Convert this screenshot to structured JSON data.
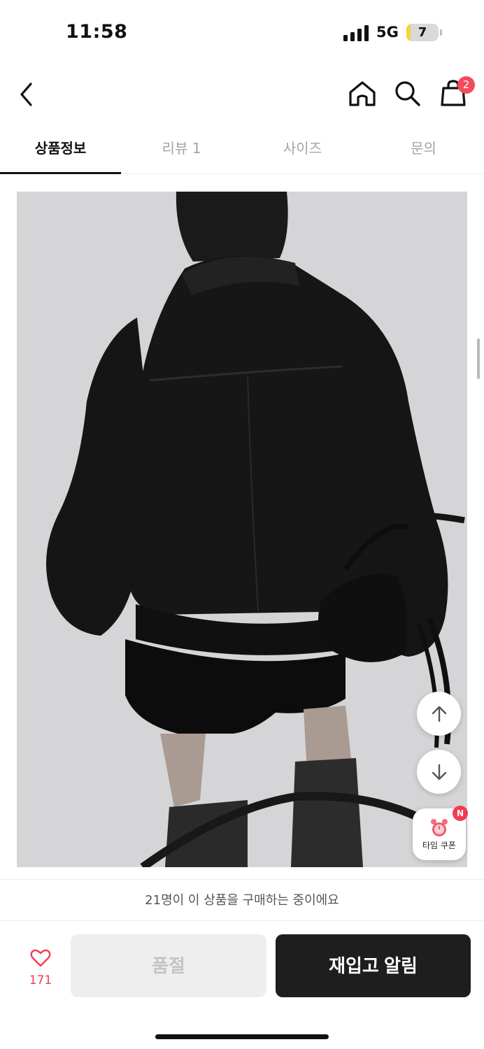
{
  "status_bar": {
    "time": "11:58",
    "network": "5G",
    "battery_level": "7",
    "battery_color": "#f5d23e"
  },
  "nav": {
    "back_icon": "chevron-left-icon",
    "home_icon": "home-icon",
    "search_icon": "search-icon",
    "cart_icon": "shopping-bag-icon",
    "cart_count": "2",
    "badge_color": "#f24c5a"
  },
  "tabs": [
    {
      "label": "상품정보",
      "active": true
    },
    {
      "label": "리뷰 1",
      "active": false
    },
    {
      "label": "사이즈",
      "active": false
    },
    {
      "label": "문의",
      "active": false
    }
  ],
  "floating": {
    "scroll_up_icon": "arrow-up-icon",
    "scroll_down_icon": "arrow-down-icon",
    "coupon_icon": "alarm-clock-icon",
    "coupon_badge": "N",
    "coupon_label": "타임 쿠폰"
  },
  "purchase_notice": "21명이 이 상품을 구매하는 중이에요",
  "bottom_bar": {
    "like_icon": "heart-icon",
    "like_count": "171",
    "soldout_label": "품절",
    "restock_label": "재입고 알림",
    "accent_color": "#f23d4f"
  }
}
